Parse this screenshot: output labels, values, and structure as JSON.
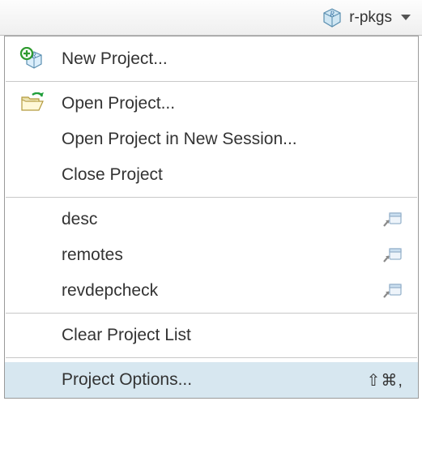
{
  "toolbar": {
    "current_project": "r-pkgs"
  },
  "menu": {
    "new_project": "New Project...",
    "open_project": "Open Project...",
    "open_in_new_session": "Open Project in New Session...",
    "close_project": "Close Project",
    "recent": [
      "desc",
      "remotes",
      "revdepcheck"
    ],
    "clear_list": "Clear Project List",
    "project_options": "Project Options...",
    "project_options_shortcut": "⇧⌘,"
  }
}
